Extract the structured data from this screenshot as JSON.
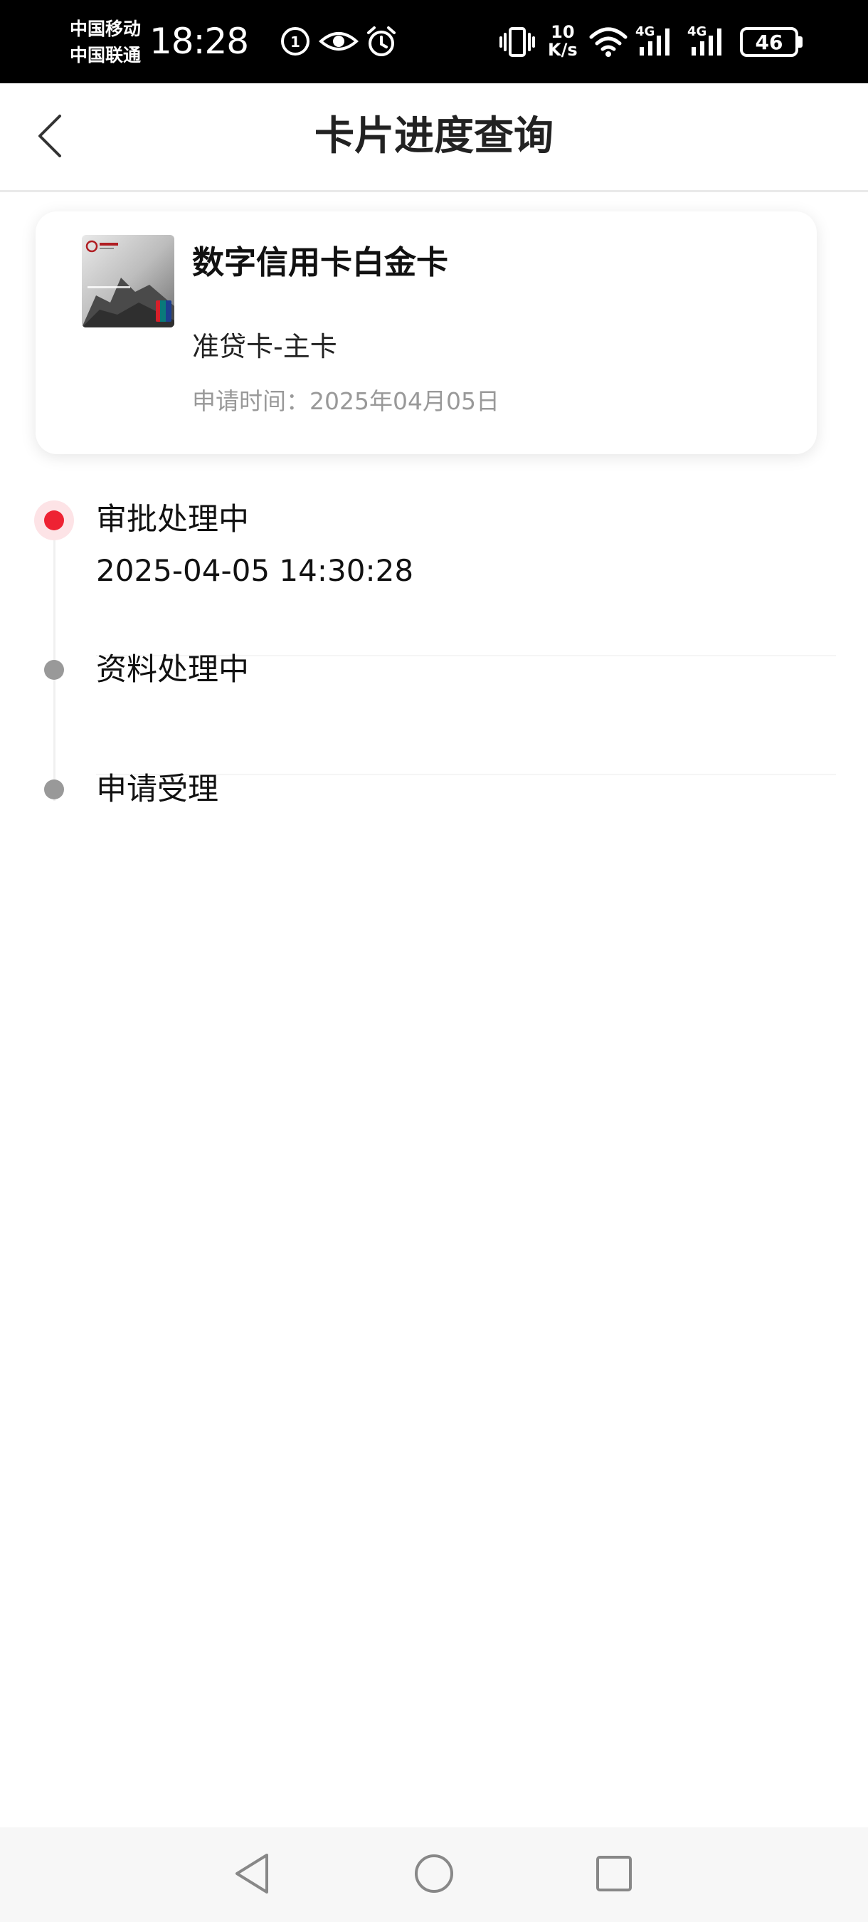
{
  "status_bar": {
    "carrier_1": "中国移动",
    "carrier_2": "中国联通",
    "time": "18:28",
    "net_speed_value": "10",
    "net_speed_unit": "K/s",
    "signal_1": "4G",
    "signal_2": "4G",
    "battery": "46",
    "icons": [
      "hd-voice-icon",
      "eye-comfort-icon",
      "alarm-icon",
      "vibrate-icon",
      "wifi-icon",
      "signal-icon",
      "signal-icon",
      "battery-icon"
    ]
  },
  "header": {
    "title": "卡片进度查询",
    "back_icon": "chevron-left-icon"
  },
  "card": {
    "name": "数字信用卡白金卡",
    "type": "准贷卡-主卡",
    "apply_time_label": "申请时间：",
    "apply_time_value": "2025年04月05日"
  },
  "timeline": {
    "steps": [
      {
        "title": "审批处理中",
        "time": "2025-04-05 14:30:28",
        "active": true
      },
      {
        "title": "资料处理中",
        "time": "",
        "active": false
      },
      {
        "title": "申请受理",
        "time": "",
        "active": false
      }
    ]
  },
  "colors": {
    "accent": "#ee2233",
    "accent_light": "#fde3e6",
    "inactive_dot": "#999999",
    "muted_text": "#999999"
  },
  "nav_bar": {
    "icons": [
      "back-triangle-icon",
      "home-circle-icon",
      "recents-square-icon"
    ]
  }
}
